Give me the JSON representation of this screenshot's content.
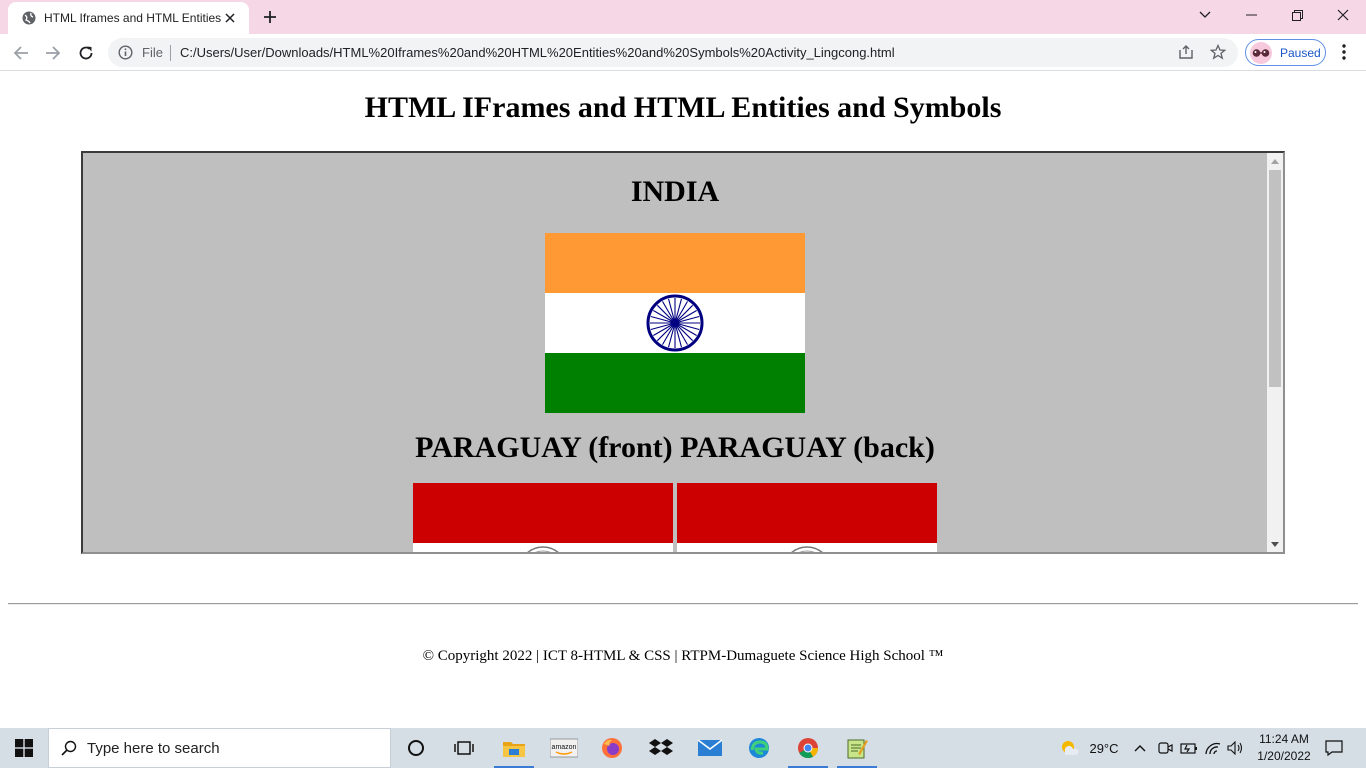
{
  "browser": {
    "tab_title": "HTML Iframes and HTML Entities",
    "address_scheme": "File",
    "url": "C:/Users/User/Downloads/HTML%20Iframes%20and%20HTML%20Entities%20and%20Symbols%20Activity_Lingcong.html",
    "profile_status": "Paused"
  },
  "page": {
    "title": "HTML IFrames and HTML Entities and Symbols",
    "iframe": {
      "india_heading": "INDIA",
      "paraguay_heading": "PARAGUAY (front) PARAGUAY (back)"
    },
    "footer": "© Copyright 2022 | ICT 8-HTML & CSS | RTPM-Dumaguete Science High School ™"
  },
  "colors": {
    "saffron": "#ff9933",
    "india_green": "#008000",
    "chakra_blue": "#000080",
    "paraguay_red": "#cc0000",
    "iframe_bg": "#bfbfbf"
  },
  "taskbar": {
    "search_placeholder": "Type here to search",
    "weather_temp": "29°C",
    "time": "11:24 AM",
    "date": "1/20/2022",
    "apps": [
      "cortana-icon",
      "task-view-icon",
      "file-explorer-icon",
      "amazon-icon",
      "firefox-icon",
      "dropbox-icon",
      "mail-icon",
      "edge-icon",
      "chrome-icon",
      "notepad-icon"
    ]
  }
}
